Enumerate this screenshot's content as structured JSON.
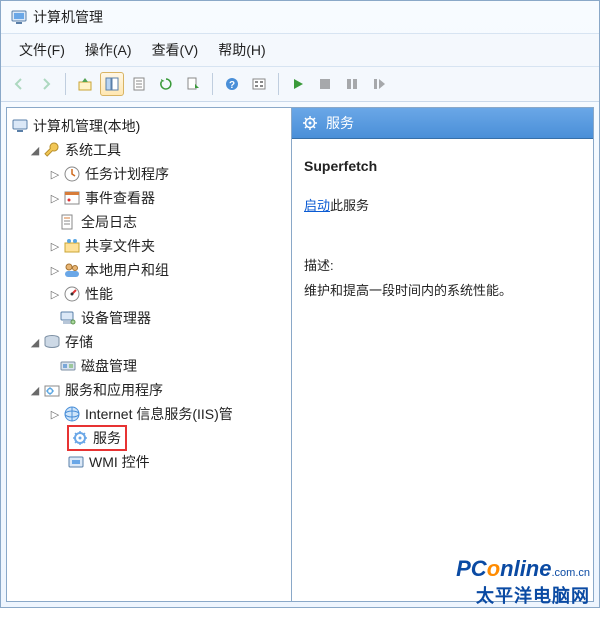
{
  "title": "计算机管理",
  "menu": {
    "file": "文件(F)",
    "action": "操作(A)",
    "view": "查看(V)",
    "help": "帮助(H)"
  },
  "tree": {
    "root": "计算机管理(本地)",
    "sys": "系统工具",
    "sys_items": {
      "task": "任务计划程序",
      "event": "事件查看器",
      "log": "全局日志",
      "share": "共享文件夹",
      "users": "本地用户和组",
      "perf": "性能",
      "devmgr": "设备管理器"
    },
    "storage": "存储",
    "storage_items": {
      "disk": "磁盘管理"
    },
    "apps": "服务和应用程序",
    "apps_items": {
      "iis": "Internet 信息服务(IIS)管",
      "services": "服务",
      "wmi": "WMI 控件"
    }
  },
  "pane": {
    "title": "服务",
    "svc": "Superfetch",
    "start": "启动",
    "start_tail": "此服务",
    "desc_label": "描述:",
    "desc": "维护和提高一段时间内的系统性能。"
  },
  "wm": {
    "a": "PC",
    "b": "o",
    "c": "nline",
    "d": ".com.cn",
    "e": "太平洋电脑网"
  }
}
